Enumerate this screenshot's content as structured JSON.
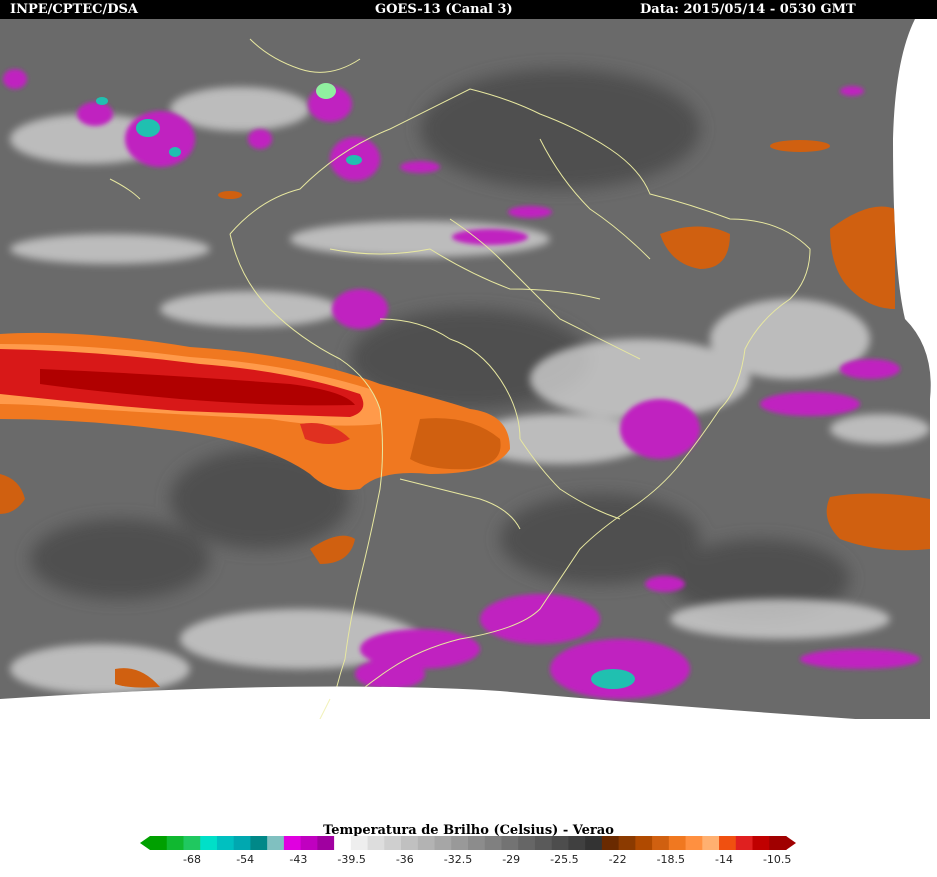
{
  "header": {
    "left": "INPE/CPTEC/DSA",
    "center": "GOES-13 (Canal 3)",
    "right": "Data: 2015/05/14 - 0530 GMT"
  },
  "legend": {
    "title": "Temperatura de Brilho (Celsius) - Verao",
    "ticks": [
      "-68",
      "-54",
      "-43",
      "-39.5",
      "-36",
      "-32.5",
      "-29",
      "-25.5",
      "-22",
      "-18.5",
      "-14",
      "-10.5"
    ],
    "segments": [
      "#00a000",
      "#10b830",
      "#20c860",
      "#00e0c8",
      "#00c0c0",
      "#00a8b0",
      "#008888",
      "#80c0c0",
      "#e000e0",
      "#c000c0",
      "#a000a0",
      "#ffffff",
      "#eeeeee",
      "#dddddd",
      "#cfcfcf",
      "#c0c0c0",
      "#b3b3b3",
      "#a6a6a6",
      "#999999",
      "#8c8c8c",
      "#808080",
      "#737373",
      "#666666",
      "#5a5a5a",
      "#4d4d4d",
      "#404040",
      "#333333",
      "#6a2a00",
      "#8b3a00",
      "#b04a00",
      "#d06010",
      "#f07820",
      "#ff9040",
      "#ffb070",
      "#f05010",
      "#e02020",
      "#c00000",
      "#a00000"
    ]
  },
  "map": {
    "colors": {
      "background_ir": "#6a6a6a",
      "cold_cloud_magenta": "#c020c0",
      "coldest_cyan": "#20c0b0",
      "warm_orange": "#f07820",
      "warm_red": "#d01010",
      "coastline": "#e8e8a0"
    }
  }
}
